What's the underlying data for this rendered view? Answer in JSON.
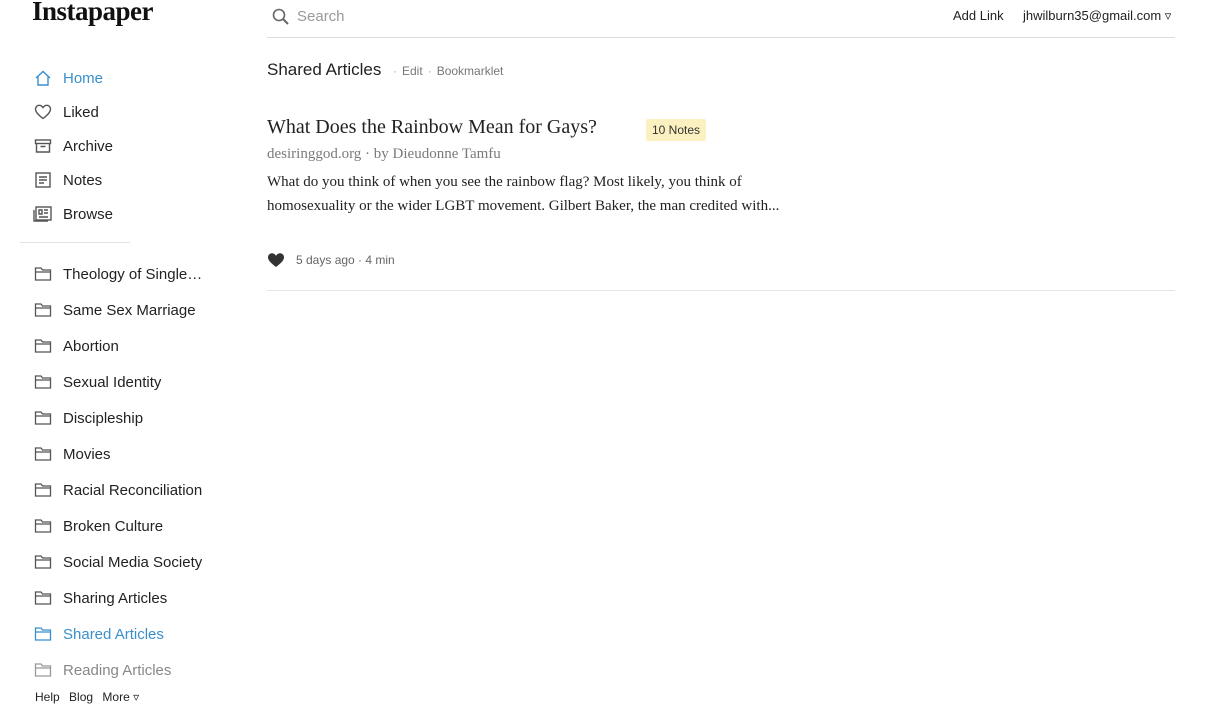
{
  "app": {
    "logo": "Instapaper"
  },
  "header": {
    "search_placeholder": "Search",
    "add_link": "Add Link",
    "account": "jhwilburn35@gmail.com ▿"
  },
  "sidebar": {
    "main": [
      {
        "label": "Home",
        "icon": "home-icon",
        "active": true
      },
      {
        "label": "Liked",
        "icon": "heart-icon"
      },
      {
        "label": "Archive",
        "icon": "archive-icon"
      },
      {
        "label": "Notes",
        "icon": "notes-icon"
      },
      {
        "label": "Browse",
        "icon": "browse-icon"
      }
    ],
    "folders": [
      {
        "label": "Theology of Singleness"
      },
      {
        "label": "Same Sex Marriage"
      },
      {
        "label": "Abortion"
      },
      {
        "label": "Sexual Identity"
      },
      {
        "label": "Discipleship"
      },
      {
        "label": "Movies"
      },
      {
        "label": "Racial Reconciliation"
      },
      {
        "label": "Broken Culture"
      },
      {
        "label": "Social Media Society"
      },
      {
        "label": "Sharing Articles"
      },
      {
        "label": "Shared Articles",
        "active": true
      },
      {
        "label": "Reading Articles"
      }
    ],
    "footer": {
      "help": "Help",
      "blog": "Blog",
      "more": "More ▿"
    }
  },
  "page": {
    "title": "Shared Articles",
    "edit": "Edit",
    "bookmarklet": "Bookmarklet",
    "separator": "·"
  },
  "article": {
    "title": "What Does the Rainbow Mean for Gays?",
    "notes_badge": "10 Notes",
    "meta": "desiringgod.org · by Dieudonne Tamfu",
    "excerpt": "What do you think of when you see the rainbow flag? Most likely, you think of homosexuality or the wider LGBT movement. Gilbert Baker, the man credited with...",
    "footer": "5 days ago · 4 min",
    "liked": true
  },
  "colors": {
    "accent": "#3b8fcc",
    "badge": "#fbf1c0"
  }
}
